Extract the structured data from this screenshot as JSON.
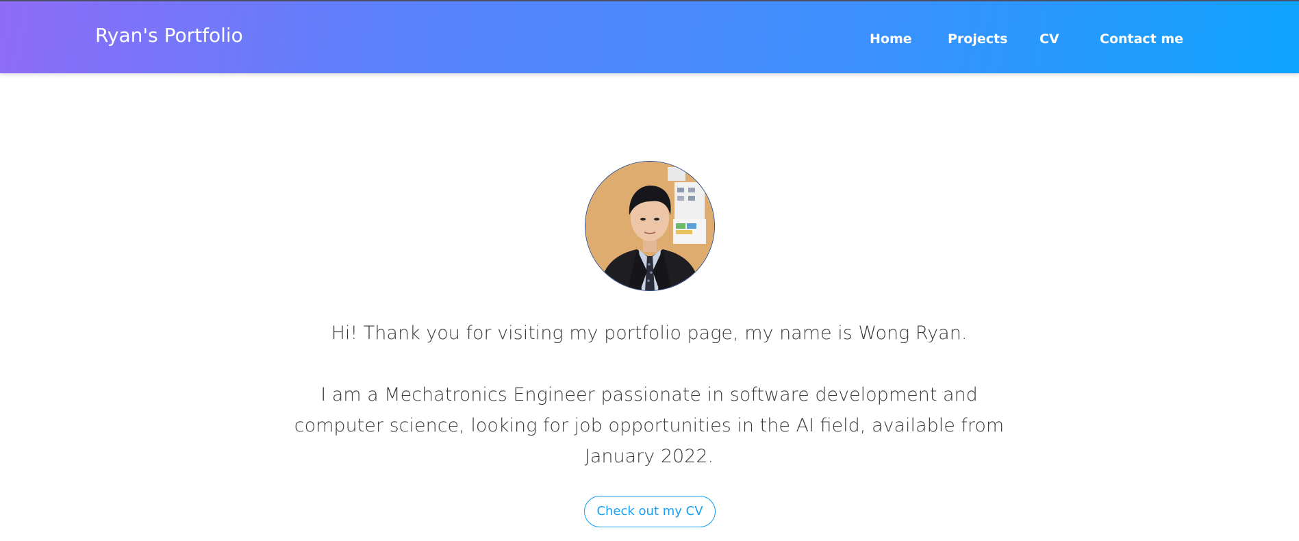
{
  "navbar": {
    "brand": "Ryan's Portfolio",
    "links": [
      {
        "label": "Home"
      },
      {
        "label": "Projects"
      },
      {
        "label": "CV"
      },
      {
        "label": "Contact me"
      }
    ]
  },
  "hero": {
    "greeting": "Hi! Thank you for visiting my portfolio page, my name is Wong Ryan.",
    "bio_line_1": "I am a Mechatronics Engineer passionate in software development and",
    "bio_line_2": "computer science, looking for job opportunities in the AI field, available from",
    "bio_line_3": "January 2022.",
    "cta_label": "Check out my CV"
  },
  "colors": {
    "gradient_start": "#8f6cf7",
    "gradient_end": "#0ea3ff",
    "accent": "#17a0f3",
    "body_text": "#3b3b3b"
  }
}
